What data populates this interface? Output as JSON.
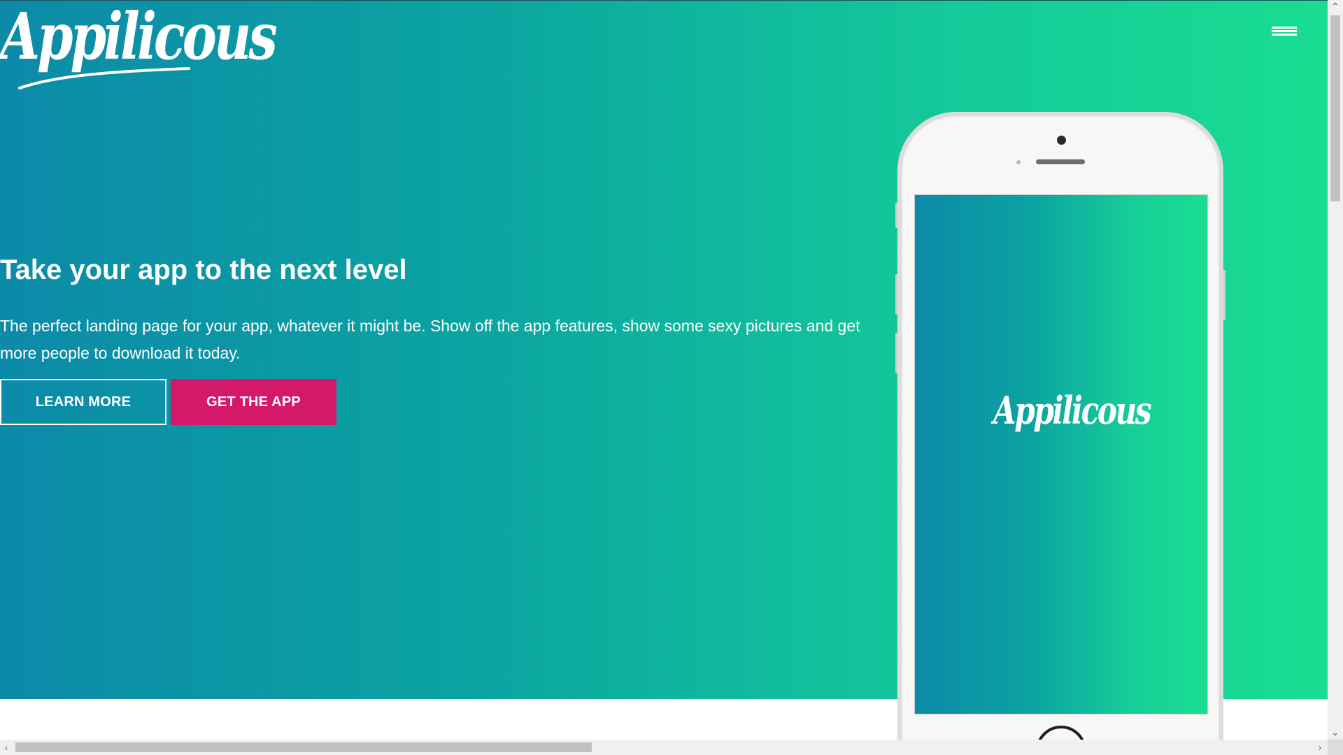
{
  "brand": {
    "logo_text": "Appilicous"
  },
  "nav": {
    "menu_icon": "hamburger-menu-icon"
  },
  "hero": {
    "headline": "Take your app to the next level",
    "lead": "The perfect landing page for your app, whatever it might be. Show off the app features, show some sexy pictures and get more people to download it today.",
    "learn_more_label": "LEARN MORE",
    "get_app_label": "GET THE APP"
  },
  "phone": {
    "screen_logo_text": "Appilicous"
  },
  "colors": {
    "gradient_start": "#0c8aa8",
    "gradient_end": "#19dd92",
    "cta_pink": "#d4196a",
    "text": "#ffffff"
  },
  "scrollbars": {
    "up_icon": "chevron-up-icon",
    "down_icon": "chevron-down-icon",
    "left_icon": "chevron-left-icon",
    "right_icon": "chevron-right-icon"
  }
}
